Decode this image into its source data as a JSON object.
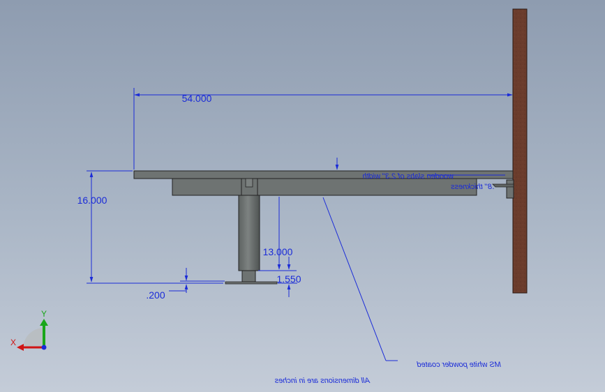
{
  "drawing": {
    "dimensions": {
      "overall_length": "54.000",
      "overall_height": "16.000",
      "pedestal_height": "13.000",
      "base_offset": "1.550",
      "base_plate_thickness": ".200"
    },
    "notes": {
      "top_slab": "wooden slabs of 2.3\" width",
      "top_thickness": ".8\" thickness",
      "frame_finish": "MS white powder coated",
      "units": "All dimensions are in inches"
    },
    "triad": {
      "x_label": "X",
      "y_label": "Y"
    }
  },
  "colors": {
    "background_top": "#8e9cb0",
    "background_bottom": "#c4ccd8",
    "dimension_blue": "#1a2bd8",
    "wall_brown": "#6b3c2c",
    "steel_gray": "#6e7372",
    "axis_green": "#1aa61a",
    "axis_red": "#d01414"
  }
}
